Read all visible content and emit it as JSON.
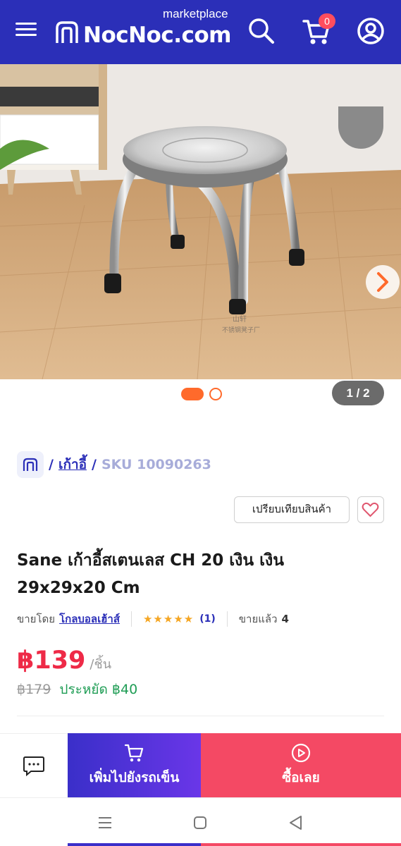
{
  "header": {
    "logo_text": "NocNoc.com",
    "logo_subtitle": "marketplace",
    "cart_count": "0",
    "icons": [
      "menu-icon",
      "logo-icon",
      "search-icon",
      "cart-icon",
      "account-icon"
    ],
    "brand_color": "#2b2fb8"
  },
  "gallery": {
    "current_index_label": "1 / 2",
    "slides": 2,
    "active_slide": 1,
    "accent_color": "#ff6a2b"
  },
  "breadcrumb": {
    "separator": "/",
    "category": "เก้าอี้",
    "sku": "SKU 10090263"
  },
  "actions": {
    "compare_label": "เปรียบเทียบสินค้า"
  },
  "product": {
    "title_line1": "Sane เก้าอี้สเตนเลส CH 20 เงิน เงิน",
    "title_line2": "29x29x20 Cm",
    "sold_by_label": "ขายโดย",
    "seller": "โกลบอลเฮ้าส์",
    "stars": "★★★★★",
    "rating_count": "(1)",
    "sold_label": "ขายแล้ว",
    "sold_count": "4",
    "price": "฿139",
    "price_unit": "/ชิ้น",
    "old_price": "฿179",
    "saving": "ประหยัด ฿40"
  },
  "bottom_bar": {
    "add_to_cart_label": "เพิ่มไปยังรถเข็น",
    "buy_now_label": "ซื้อเลย",
    "colors": {
      "add_to_cart": "#4a32d6",
      "buy_now": "#f44964"
    }
  }
}
